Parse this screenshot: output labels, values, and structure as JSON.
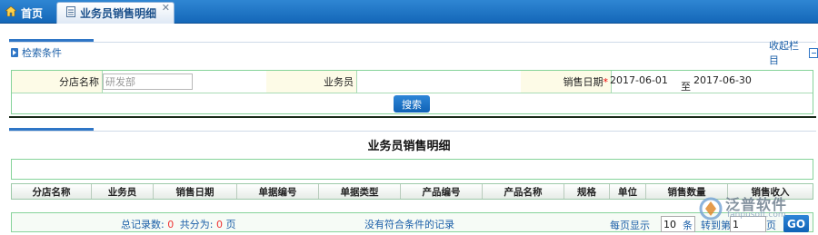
{
  "tabs": {
    "home": "首页",
    "active": "业务员销售明细"
  },
  "search": {
    "title": "检索条件",
    "collapse": "收起栏目",
    "branch_label": "分店名称",
    "branch_placeholder": "研发部",
    "salesman_label": "业务员",
    "date_label": "销售日期",
    "required_mark": "*",
    "date_from": "2017-06-01",
    "date_to_label": "至",
    "date_to": "2017-06-30",
    "search_button": "搜索"
  },
  "results": {
    "title": "业务员销售明细",
    "columns": [
      "分店名称",
      "业务员",
      "销售日期",
      "单据编号",
      "单据类型",
      "产品编号",
      "产品名称",
      "规格",
      "单位",
      "销售数量",
      "销售收入"
    ]
  },
  "pager": {
    "total_label": "总记录数:",
    "total": "0",
    "pages_label": "共分为:",
    "pages": "0",
    "pages_unit": "页",
    "no_records": "没有符合条件的记录",
    "per_page_label": "每页显示",
    "per_page": "10",
    "per_page_unit": "条",
    "goto_label": "转到第",
    "goto_value": "1",
    "goto_unit": "页",
    "go_button": "GO"
  },
  "watermark": {
    "brand": "泛普软件",
    "site": "fanpusoft.com"
  }
}
